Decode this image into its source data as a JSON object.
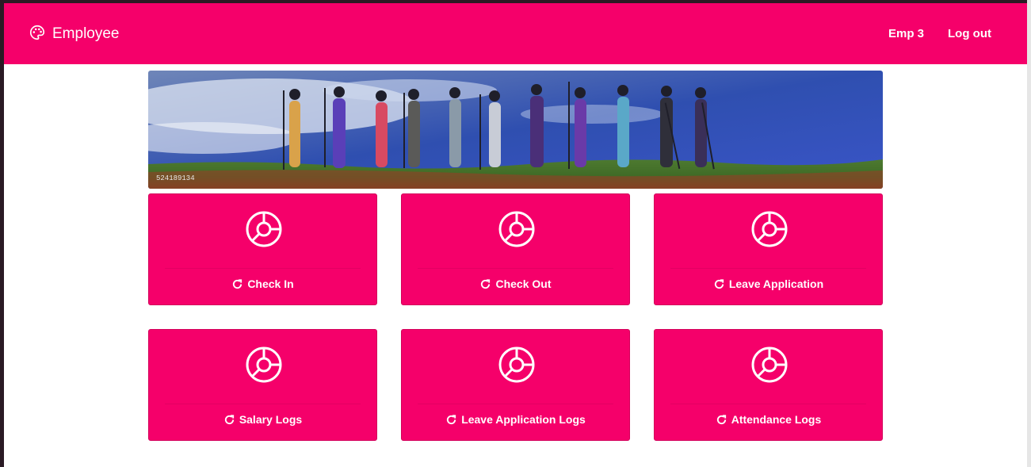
{
  "navbar": {
    "brand_icon": "palette-icon",
    "brand": "Employee",
    "user": "Emp 3",
    "logout": "Log out",
    "background": "#f5006a"
  },
  "banner": {
    "alt": "Workers standing in a field holding hoes",
    "watermark": "524189134"
  },
  "cards": [
    {
      "icon": "donut-chart-icon",
      "footer_icon": "refresh-icon",
      "label": "Check In"
    },
    {
      "icon": "donut-chart-icon",
      "footer_icon": "refresh-icon",
      "label": "Check Out"
    },
    {
      "icon": "donut-chart-icon",
      "footer_icon": "refresh-icon",
      "label": "Leave Application"
    },
    {
      "icon": "donut-chart-icon",
      "footer_icon": "refresh-icon",
      "label": "Salary Logs"
    },
    {
      "icon": "donut-chart-icon",
      "footer_icon": "refresh-icon",
      "label": "Leave Application Logs"
    },
    {
      "icon": "donut-chart-icon",
      "footer_icon": "refresh-icon",
      "label": "Attendance Logs"
    }
  ],
  "colors": {
    "accent": "#f5006a",
    "text_on_accent": "#ffffff"
  }
}
